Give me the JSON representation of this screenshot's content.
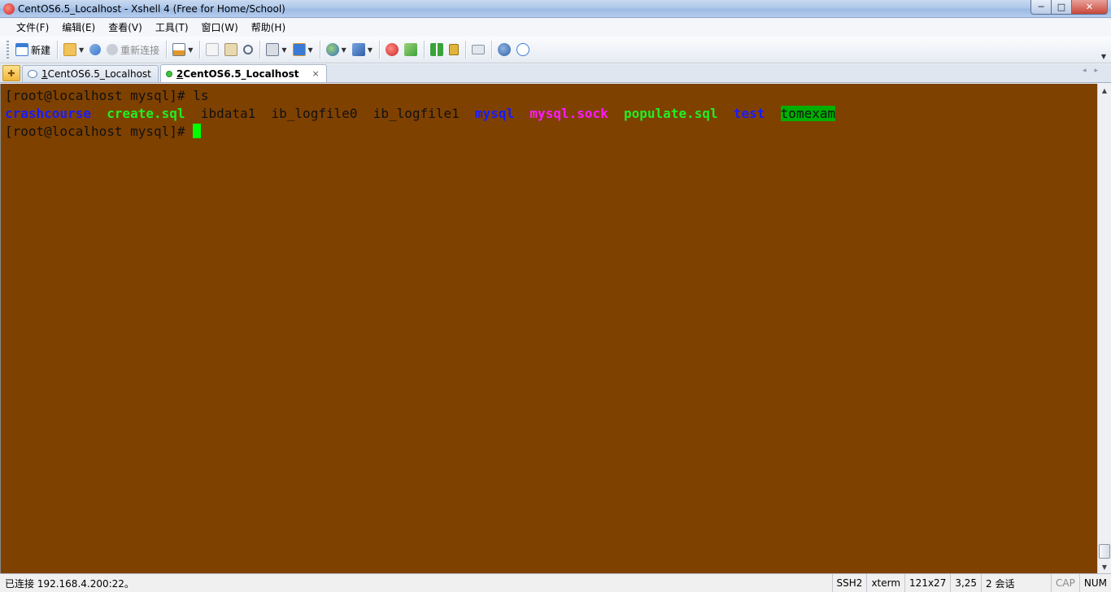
{
  "window": {
    "title": "CentOS6.5_Localhost - Xshell 4 (Free for Home/School)",
    "controls": {
      "minimize": "─",
      "maximize": "□",
      "close": "✕"
    }
  },
  "menu": [
    "文件(F)",
    "编辑(E)",
    "查看(V)",
    "工具(T)",
    "窗口(W)",
    "帮助(H)"
  ],
  "toolbar": {
    "new_label": "新建",
    "reconnect_label": "重新连接",
    "icons": [
      "new-session-icon",
      "open-folder-icon",
      "connect-icon",
      "reconnect-icon",
      "properties-icon",
      "copy-icon",
      "paste-icon",
      "find-icon",
      "print-icon",
      "transfer-icon",
      "globe-icon",
      "font-icon",
      "xftp-icon",
      "compose-icon",
      "layout-icon",
      "lock-icon",
      "keyboard-icon",
      "help-icon",
      "chat-icon"
    ],
    "colors": {
      "blue": "#3a7bd5",
      "orange": "#e0972b",
      "green": "#3aa33a",
      "red": "#d23b2e",
      "gray": "#8895a6"
    }
  },
  "tabs": [
    {
      "number": "1",
      "label": " CentOS6.5_Localhost",
      "active": false
    },
    {
      "number": "2",
      "label": " CentOS6.5_Localhost",
      "active": true
    }
  ],
  "tab_close": "×",
  "tab_nav": "◂▸",
  "terminal": {
    "background": "#7f4100",
    "lines": [
      [
        {
          "text": "[root@localhost mysql]# ls",
          "style": "plain"
        }
      ],
      [
        {
          "text": "crashcourse",
          "style": "blue"
        },
        {
          "text": "  ",
          "style": "plain"
        },
        {
          "text": "create.sql",
          "style": "green"
        },
        {
          "text": "  ibdata1  ib_logfile0  ib_logfile1  ",
          "style": "plain"
        },
        {
          "text": "mysql",
          "style": "blue"
        },
        {
          "text": "  ",
          "style": "plain"
        },
        {
          "text": "mysql.sock",
          "style": "magenta"
        },
        {
          "text": "  ",
          "style": "plain"
        },
        {
          "text": "populate.sql",
          "style": "green"
        },
        {
          "text": "  ",
          "style": "plain"
        },
        {
          "text": "test",
          "style": "blue"
        },
        {
          "text": "  ",
          "style": "plain"
        },
        {
          "text": "tomexam",
          "style": "hl"
        }
      ],
      [
        {
          "text": "[root@localhost mysql]# ",
          "style": "plain"
        }
      ]
    ]
  },
  "status": {
    "connection": "已连接 192.168.4.200:22。",
    "protocol": "SSH2",
    "terminal_type": "xterm",
    "size": "121x27",
    "cursor_pos": "3,25",
    "sessions": "2 会话",
    "caps": "CAP",
    "num": "NUM"
  }
}
